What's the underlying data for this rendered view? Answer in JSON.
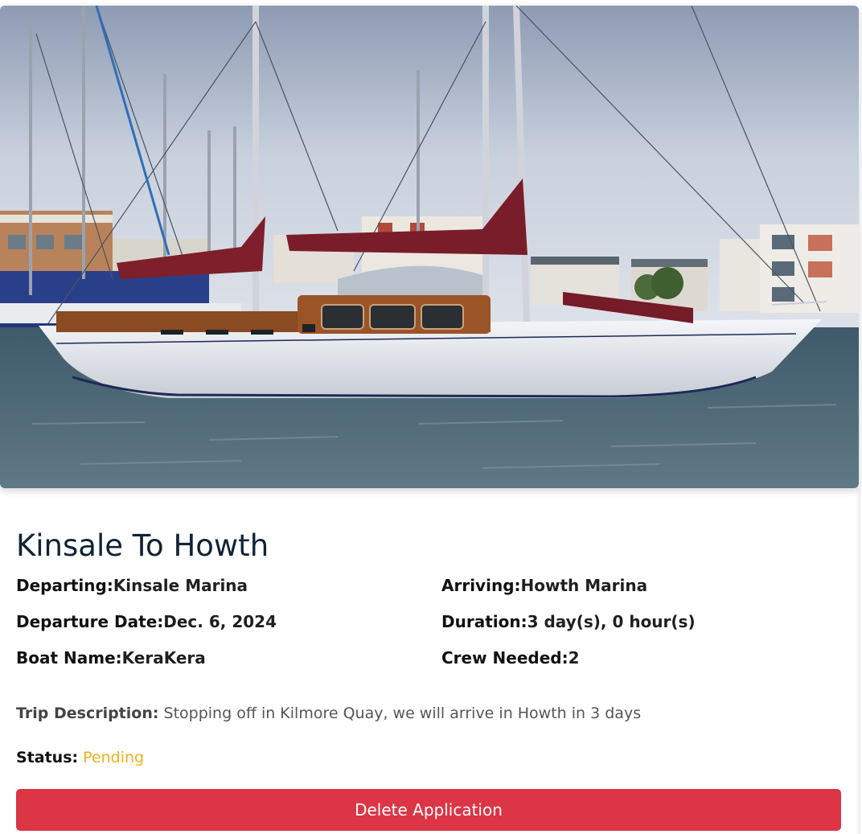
{
  "trip": {
    "title": "Kinsale To Howth",
    "departing_label": "Departing:",
    "departing_value": "Kinsale Marina",
    "arriving_label": "Arriving:",
    "arriving_value": "Howth Marina",
    "departure_date_label": "Departure Date:",
    "departure_date_value": "Dec. 6, 2024",
    "duration_label": "Duration:",
    "duration_value": "3 day(s), 0 hour(s)",
    "boat_name_label": "Boat Name:",
    "boat_name_value": "KeraKera",
    "crew_needed_label": "Crew Needed:",
    "crew_needed_value": "2",
    "description_label": "Trip Description:",
    "description_value": "Stopping off in Kilmore Quay, we will arrive in Howth in 3 days",
    "status_label": "Status:",
    "status_value": "Pending"
  },
  "actions": {
    "delete_label": "Delete Application"
  },
  "colors": {
    "title": "#0f2336",
    "status_pending": "#f2b01e",
    "delete_button": "#dc3545"
  }
}
